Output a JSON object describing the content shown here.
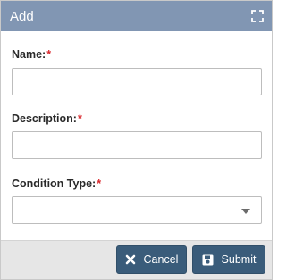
{
  "dialog": {
    "title": "Add",
    "maximize_icon": "maximize-icon"
  },
  "form": {
    "name": {
      "label": "Name:",
      "required_mark": "*",
      "value": ""
    },
    "description": {
      "label": "Description:",
      "required_mark": "*",
      "value": ""
    },
    "condition_type": {
      "label": "Condition Type:",
      "required_mark": "*",
      "selected": ""
    }
  },
  "footer": {
    "cancel_label": "Cancel",
    "cancel_icon": "close-icon",
    "submit_label": "Submit",
    "submit_icon": "save-icon"
  },
  "colors": {
    "titlebar": "#8196b3",
    "button": "#3a5c7a",
    "required": "#d9262b",
    "footer": "#e6e6e6"
  }
}
